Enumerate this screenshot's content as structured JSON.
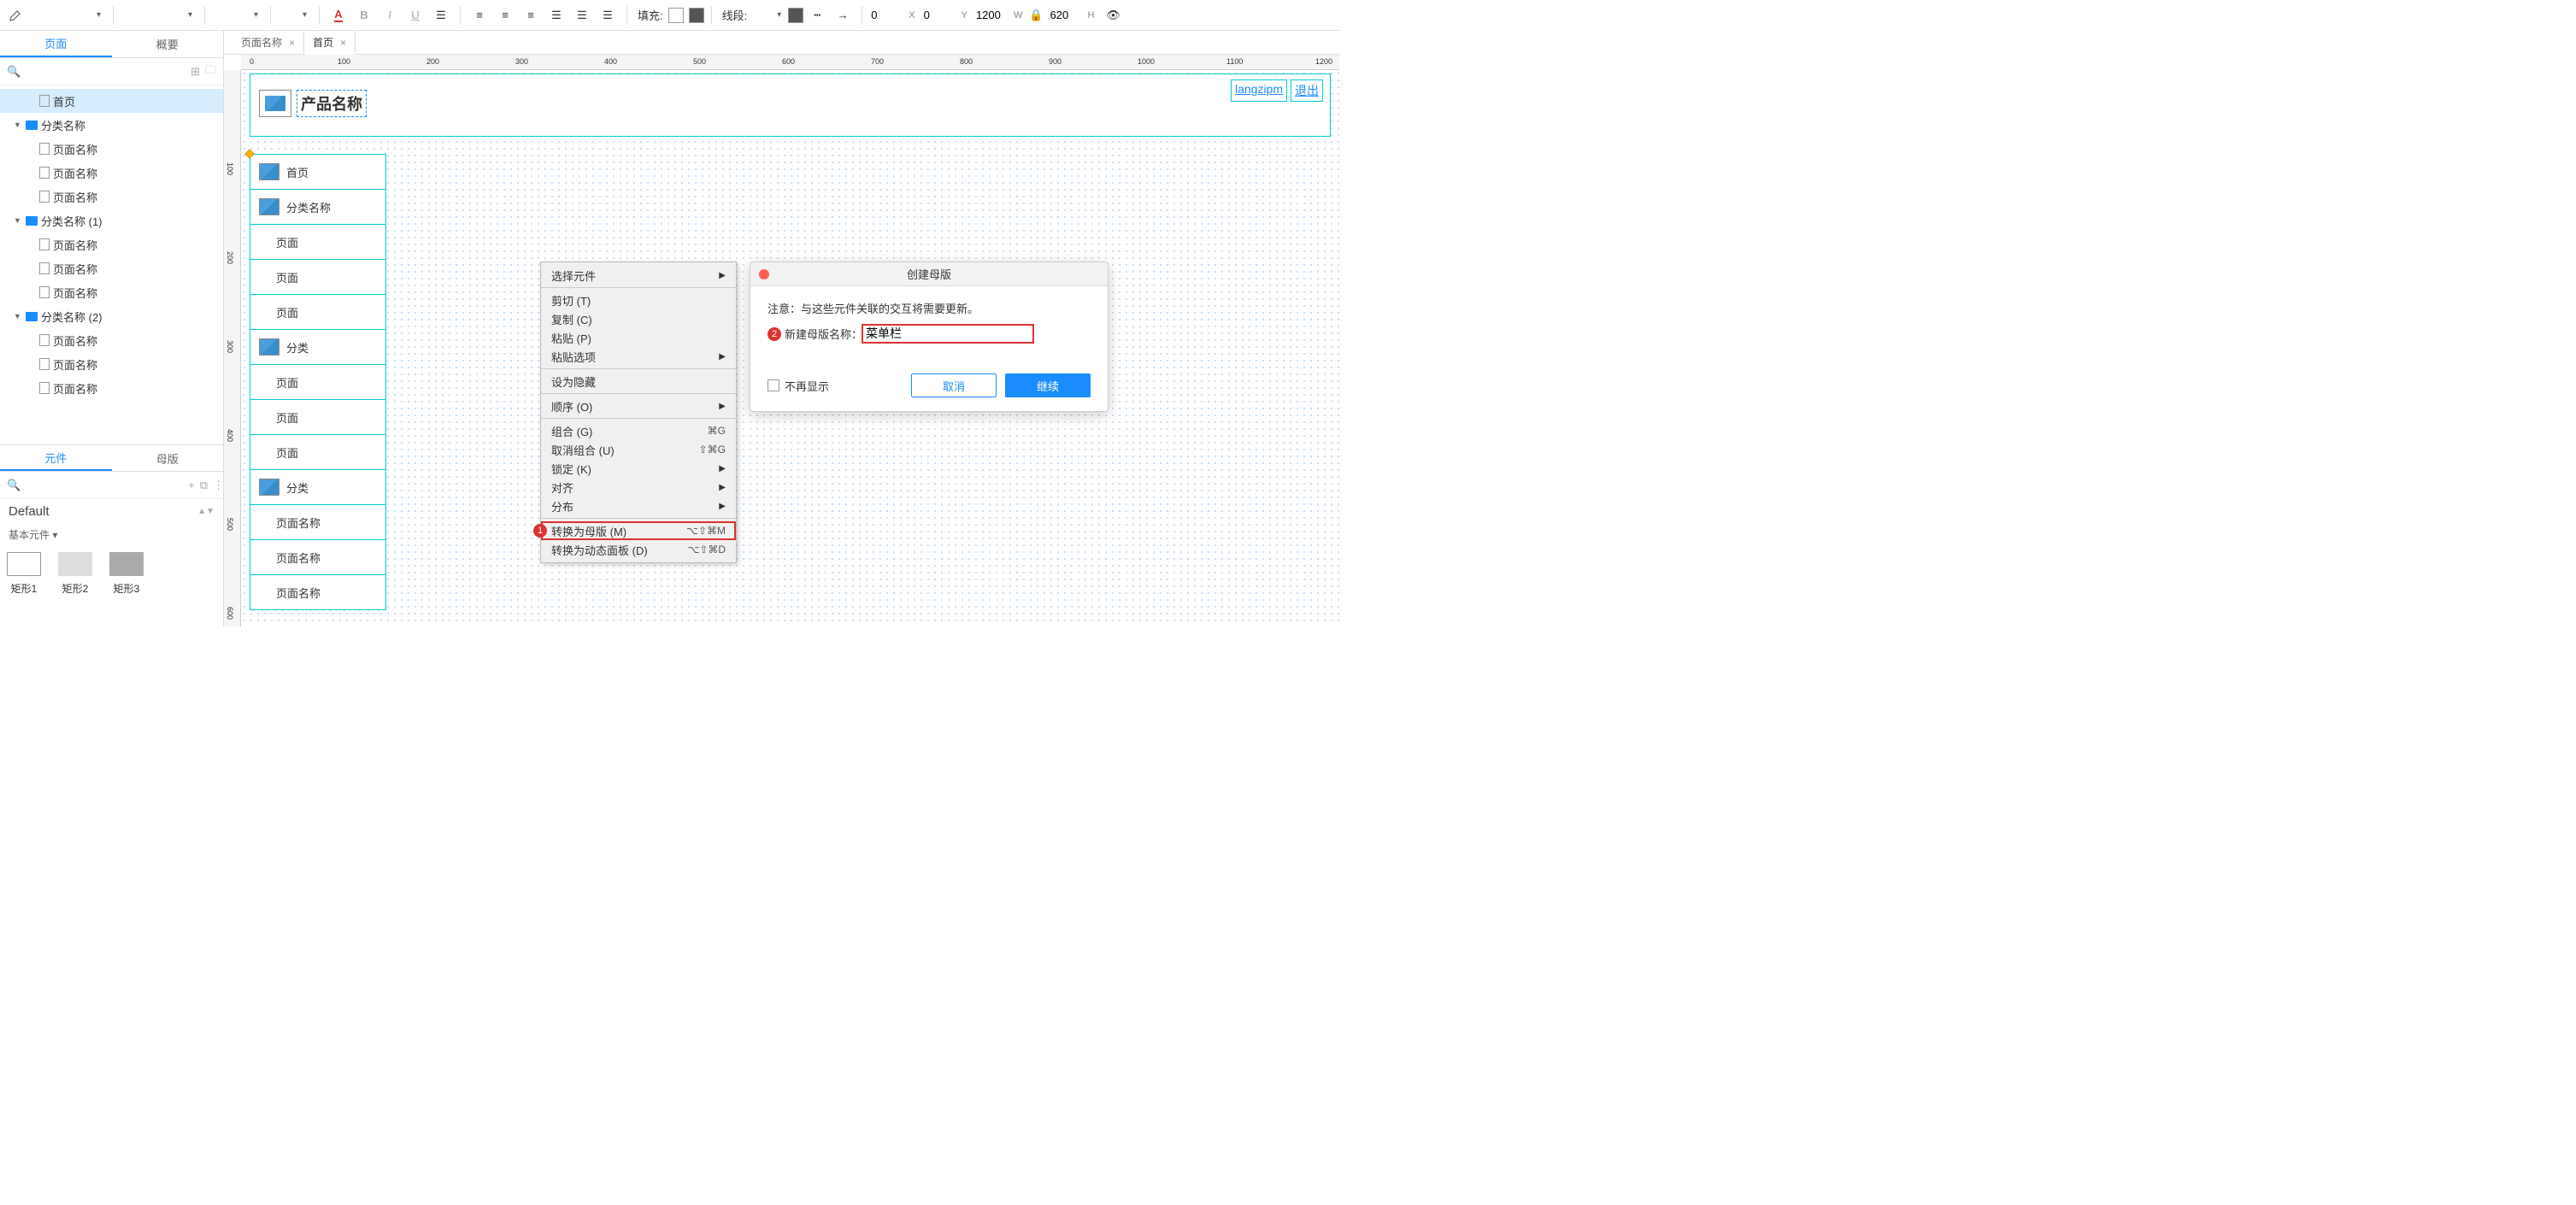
{
  "toolbar": {
    "fill_label": "填充:",
    "line_label": "线段:",
    "x": "0",
    "y": "0",
    "w": "1200",
    "h": "620",
    "x_label": "X",
    "y_label": "Y",
    "w_label": "W",
    "h_label": "H"
  },
  "left_panel": {
    "tabs": {
      "pages": "页面",
      "outline": "概要"
    },
    "tree": {
      "home": "首页",
      "cat1": "分类名称",
      "cat2": "分类名称 (1)",
      "cat3": "分类名称 (2)",
      "page": "页面名称"
    },
    "lib_tabs": {
      "widgets": "元件",
      "masters": "母版"
    },
    "library": "Default",
    "section": "基本元件 ▾",
    "shapes": {
      "r1": "矩形1",
      "r2": "矩形2",
      "r3": "矩形3"
    }
  },
  "doc_tabs": {
    "t1": "页面名称",
    "t2": "首页"
  },
  "canvas": {
    "product": "产品名称",
    "user": "langzipm",
    "logout": "退出",
    "menu": {
      "home": "首页",
      "cat": "分类名称",
      "cat2": "分类",
      "page": "页面名称",
      "page_trunc": "页面"
    }
  },
  "context_menu": {
    "select": "选择元件",
    "cut": "剪切 (T)",
    "copy": "复制 (C)",
    "paste": "粘贴 (P)",
    "paste_opts": "粘贴选项",
    "hide": "设为隐藏",
    "order": "顺序 (O)",
    "group": "组合 (G)",
    "group_k": "⌘G",
    "ungroup": "取消组合 (U)",
    "ungroup_k": "⇧⌘G",
    "lock": "锁定 (K)",
    "align": "对齐",
    "distribute": "分布",
    "to_master": "转换为母版 (M)",
    "to_master_k": "⌥⇧⌘M",
    "to_panel": "转换为动态面板 (D)",
    "to_panel_k": "⌥⇧⌘D"
  },
  "modal": {
    "title": "创建母版",
    "notice": "注意：与这些元件关联的交互将需要更新。",
    "field_label": "新建母版名称：",
    "field_value": "菜单栏",
    "dont_show": "不再显示",
    "cancel": "取消",
    "continue": "继续"
  },
  "badges": {
    "one": "1",
    "two": "2"
  },
  "ruler_h": [
    "0",
    "100",
    "200",
    "300",
    "400",
    "500",
    "600",
    "700",
    "800",
    "900",
    "1000",
    "1100",
    "1200"
  ],
  "ruler_v": [
    "100",
    "200",
    "300",
    "400",
    "500",
    "600"
  ]
}
